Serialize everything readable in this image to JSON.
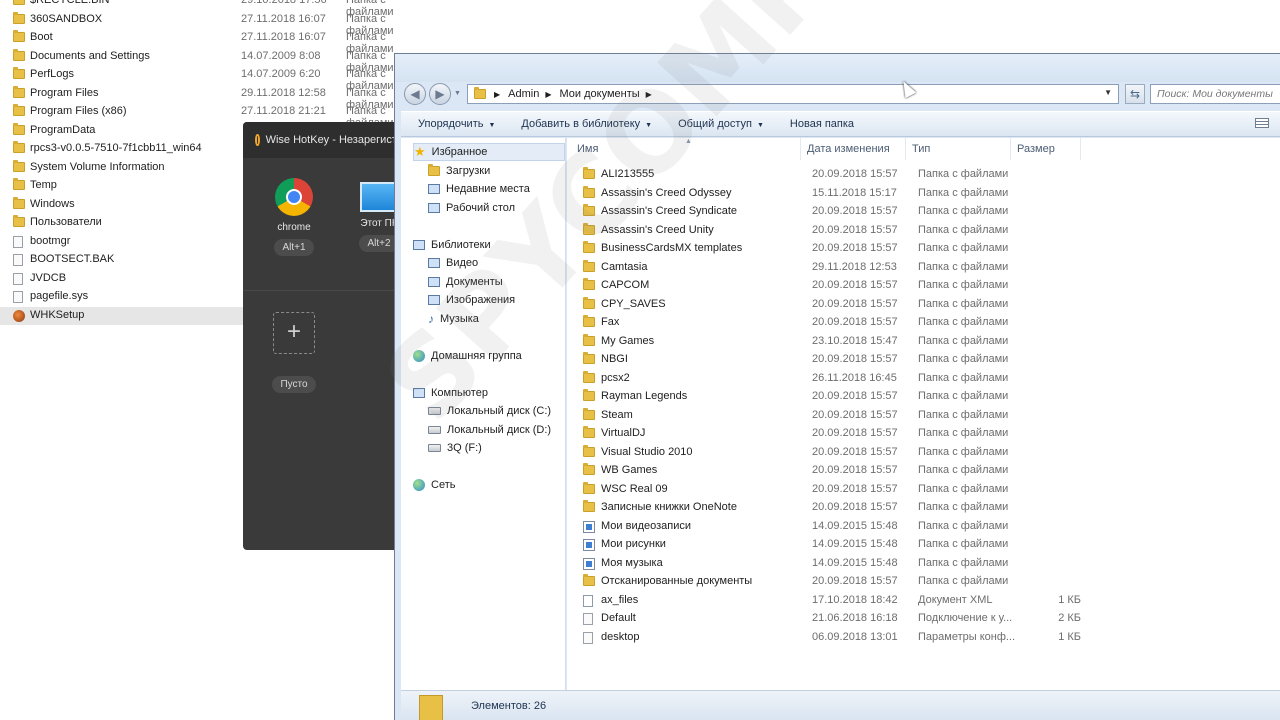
{
  "background_list": [
    {
      "name": "$RECYCLE.BIN",
      "date": "29.10.2018 17:56",
      "type": "Папка с файлами",
      "icon": "folder-icon"
    },
    {
      "name": "360SANDBOX",
      "date": "27.11.2018 16:07",
      "type": "Папка с файлами",
      "icon": "folder-icon"
    },
    {
      "name": "Boot",
      "date": "27.11.2018 16:07",
      "type": "Папка с файлами",
      "icon": "folder-icon"
    },
    {
      "name": "Documents and Settings",
      "date": "14.07.2009 8:08",
      "type": "Папка с файлами",
      "icon": "folder-icon"
    },
    {
      "name": "PerfLogs",
      "date": "14.07.2009 6:20",
      "type": "Папка с файлами",
      "icon": "folder-icon"
    },
    {
      "name": "Program Files",
      "date": "29.11.2018 12:58",
      "type": "Папка с файлами",
      "icon": "folder-icon"
    },
    {
      "name": "Program Files (x86)",
      "date": "27.11.2018 21:21",
      "type": "Папка с файлами",
      "icon": "folder-icon"
    },
    {
      "name": "ProgramData",
      "date": "",
      "type": "",
      "icon": "folder-icon"
    },
    {
      "name": "rpcs3-v0.0.5-7510-7f1cbb11_win64",
      "date": "",
      "type": "",
      "icon": "folder-icon"
    },
    {
      "name": "System Volume Information",
      "date": "",
      "type": "",
      "icon": "folder-icon"
    },
    {
      "name": "Temp",
      "date": "",
      "type": "",
      "icon": "folder-icon"
    },
    {
      "name": "Windows",
      "date": "",
      "type": "",
      "icon": "folder-icon"
    },
    {
      "name": "Пользователи",
      "date": "",
      "type": "",
      "icon": "folder-icon"
    },
    {
      "name": "bootmgr",
      "date": "",
      "type": "",
      "icon": "file-icon"
    },
    {
      "name": "BOOTSECT.BAK",
      "date": "",
      "type": "",
      "icon": "file-icon"
    },
    {
      "name": "JVDCB",
      "date": "",
      "type": "",
      "icon": "file-icon"
    },
    {
      "name": "pagefile.sys",
      "date": "",
      "type": "",
      "icon": "file-icon"
    },
    {
      "name": "WHKSetup",
      "date": "",
      "type": "",
      "icon": "app-icon"
    }
  ],
  "hotkey": {
    "title": "Wise HotKey - Незарегистр",
    "tiles": [
      {
        "label": "chrome",
        "key": "Alt+1",
        "icon": "chrome-icon"
      },
      {
        "label": "Этот ПК",
        "key": "Alt+2",
        "icon": "computer-icon"
      }
    ],
    "empty_tile": {
      "symbol": "+",
      "label": "Пусто"
    }
  },
  "explorer": {
    "address": {
      "crumbs": [
        "Admin",
        "Мои документы"
      ]
    },
    "search_placeholder": "Поиск: Мои документы",
    "toolbar": [
      "Упорядочить",
      "Добавить в библиотеку",
      "Общий доступ",
      "Новая папка"
    ],
    "nav": [
      {
        "label": "Избранное",
        "icon": "star-icon",
        "level": 0,
        "selected": true
      },
      {
        "label": "Загрузки",
        "icon": "downloads-icon",
        "level": 1
      },
      {
        "label": "Недавние места",
        "icon": "recent-places-icon",
        "level": 1
      },
      {
        "label": "Рабочий стол",
        "icon": "desktop-icon",
        "level": 1
      },
      {
        "label": "Библиотеки",
        "icon": "libraries-icon",
        "level": 0,
        "gap": true
      },
      {
        "label": "Видео",
        "icon": "video-icon",
        "level": 1
      },
      {
        "label": "Документы",
        "icon": "documents-icon",
        "level": 1
      },
      {
        "label": "Изображения",
        "icon": "pictures-icon",
        "level": 1
      },
      {
        "label": "Музыка",
        "icon": "music-icon",
        "level": 1
      },
      {
        "label": "Домашняя группа",
        "icon": "homegroup-icon",
        "level": 0,
        "gap": true
      },
      {
        "label": "Компьютер",
        "icon": "computer-icon",
        "level": 0,
        "gap": true
      },
      {
        "label": "Локальный диск (C:)",
        "icon": "drive-icon",
        "level": 1
      },
      {
        "label": "Локальный диск (D:)",
        "icon": "drive-icon",
        "level": 1
      },
      {
        "label": "3Q (F:)",
        "icon": "drive-icon",
        "level": 1
      },
      {
        "label": "Сеть",
        "icon": "network-icon",
        "level": 0,
        "gap": true
      }
    ],
    "columns": [
      "Имя",
      "Дата изменения",
      "Тип",
      "Размер"
    ],
    "files": [
      {
        "name": "ALI213555",
        "date": "20.09.2018 15:57",
        "type": "Папка с файлами",
        "size": "",
        "icon": "folder-icon"
      },
      {
        "name": "Assassin's Creed Odyssey",
        "date": "15.11.2018 15:17",
        "type": "Папка с файлами",
        "size": "",
        "icon": "folder-icon"
      },
      {
        "name": "Assassin's Creed Syndicate",
        "date": "20.09.2018 15:57",
        "type": "Папка с файлами",
        "size": "",
        "icon": "folder-icon"
      },
      {
        "name": "Assassin's Creed Unity",
        "date": "20.09.2018 15:57",
        "type": "Папка с файлами",
        "size": "",
        "icon": "folder-icon"
      },
      {
        "name": "BusinessCardsMX templates",
        "date": "20.09.2018 15:57",
        "type": "Папка с файлами",
        "size": "",
        "icon": "folder-icon"
      },
      {
        "name": "Camtasia",
        "date": "29.11.2018 12:53",
        "type": "Папка с файлами",
        "size": "",
        "icon": "folder-icon"
      },
      {
        "name": "CAPCOM",
        "date": "20.09.2018 15:57",
        "type": "Папка с файлами",
        "size": "",
        "icon": "folder-icon"
      },
      {
        "name": "CPY_SAVES",
        "date": "20.09.2018 15:57",
        "type": "Папка с файлами",
        "size": "",
        "icon": "folder-icon"
      },
      {
        "name": "Fax",
        "date": "20.09.2018 15:57",
        "type": "Папка с файлами",
        "size": "",
        "icon": "folder-icon"
      },
      {
        "name": "My Games",
        "date": "23.10.2018 15:47",
        "type": "Папка с файлами",
        "size": "",
        "icon": "folder-icon"
      },
      {
        "name": "NBGI",
        "date": "20.09.2018 15:57",
        "type": "Папка с файлами",
        "size": "",
        "icon": "folder-icon"
      },
      {
        "name": "pcsx2",
        "date": "26.11.2018 16:45",
        "type": "Папка с файлами",
        "size": "",
        "icon": "folder-icon"
      },
      {
        "name": "Rayman Legends",
        "date": "20.09.2018 15:57",
        "type": "Папка с файлами",
        "size": "",
        "icon": "folder-icon"
      },
      {
        "name": "Steam",
        "date": "20.09.2018 15:57",
        "type": "Папка с файлами",
        "size": "",
        "icon": "folder-icon"
      },
      {
        "name": "VirtualDJ",
        "date": "20.09.2018 15:57",
        "type": "Папка с файлами",
        "size": "",
        "icon": "folder-icon"
      },
      {
        "name": "Visual Studio 2010",
        "date": "20.09.2018 15:57",
        "type": "Папка с файлами",
        "size": "",
        "icon": "folder-icon"
      },
      {
        "name": "WB Games",
        "date": "20.09.2018 15:57",
        "type": "Папка с файлами",
        "size": "",
        "icon": "folder-icon"
      },
      {
        "name": "WSC Real 09",
        "date": "20.09.2018 15:57",
        "type": "Папка с файлами",
        "size": "",
        "icon": "folder-icon"
      },
      {
        "name": "Записные книжки OneNote",
        "date": "20.09.2018 15:57",
        "type": "Папка с файлами",
        "size": "",
        "icon": "folder-icon"
      },
      {
        "name": "Мои видеозаписи",
        "date": "14.09.2015 15:48",
        "type": "Папка с файлами",
        "size": "",
        "icon": "shortcut-icon"
      },
      {
        "name": "Мои рисунки",
        "date": "14.09.2015 15:48",
        "type": "Папка с файлами",
        "size": "",
        "icon": "shortcut-icon"
      },
      {
        "name": "Моя музыка",
        "date": "14.09.2015 15:48",
        "type": "Папка с файлами",
        "size": "",
        "icon": "shortcut-icon"
      },
      {
        "name": "Отсканированные документы",
        "date": "20.09.2018 15:57",
        "type": "Папка с файлами",
        "size": "",
        "icon": "folder-icon"
      },
      {
        "name": "ax_files",
        "date": "17.10.2018 18:42",
        "type": "Документ XML",
        "size": "1 КБ",
        "icon": "xml-file-icon"
      },
      {
        "name": "Default",
        "date": "21.06.2018 16:18",
        "type": "Подключение к у...",
        "size": "2 КБ",
        "icon": "rdp-file-icon"
      },
      {
        "name": "desktop",
        "date": "06.09.2018 13:01",
        "type": "Параметры конф...",
        "size": "1 КБ",
        "icon": "settings-file-icon"
      }
    ],
    "status": "Элементов: 26"
  },
  "watermark": "SPYCOMP.com"
}
